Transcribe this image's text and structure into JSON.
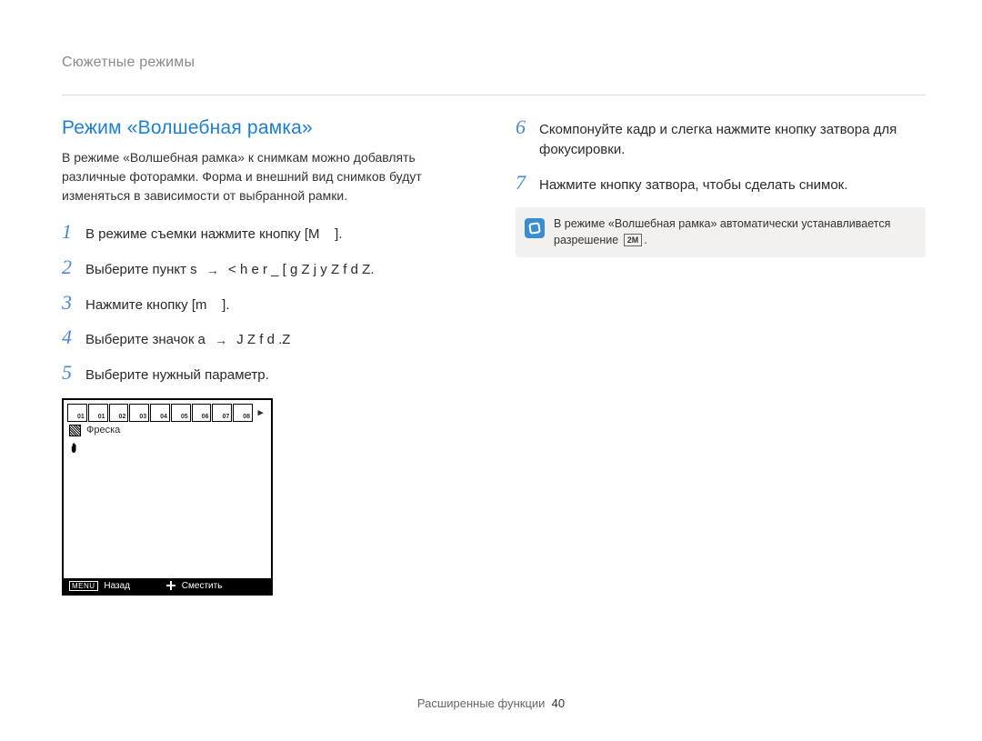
{
  "breadcrumb": "Сюжетные режимы",
  "title": "Режим «Волшебная рамка»",
  "intro": "В режиме «Волшебная рамка» к снимкам можно добавлять различные фоторамки. Форма и внешний вид снимков будут изменяться в зависимости от выбранной рамки.",
  "steps_left": [
    {
      "n": "1",
      "text_before": "В режиме съемки нажмите кнопку [M",
      "text_after": "]."
    },
    {
      "n": "2",
      "text_before": "Выберите пункт s",
      "arrow": true,
      "tail": "< h e r _ [ g Z j y  Z f d Z."
    },
    {
      "n": "3",
      "text_before": "Нажмите кнопку [m",
      "text_after": "]."
    },
    {
      "n": "4",
      "text_before": "Выберите значок a",
      "arrow": true,
      "tail": "J Z f d .Z"
    },
    {
      "n": "5",
      "text_before": "Выберите нужный параметр."
    }
  ],
  "preview": {
    "thumbs": [
      "01",
      "01",
      "02",
      "03",
      "04",
      "05",
      "06",
      "07",
      "08"
    ],
    "label": "Фреска",
    "bar_left_tag": "MENU",
    "bar_left": "Назад",
    "bar_right": "Сместить"
  },
  "steps_right": [
    {
      "n": "6",
      "text": "Скомпонуйте кадр и слегка нажмите кнопку затвора для фокусировки."
    },
    {
      "n": "7",
      "text": "Нажмите кнопку затвора, чтобы сделать снимок."
    }
  ],
  "note": {
    "prefix": "В режиме «Волшебная рамка» автоматически устанавливается разрешение",
    "res": "2M",
    "suffix": "."
  },
  "footer": {
    "label": "Расширенные функции",
    "page": "40"
  }
}
